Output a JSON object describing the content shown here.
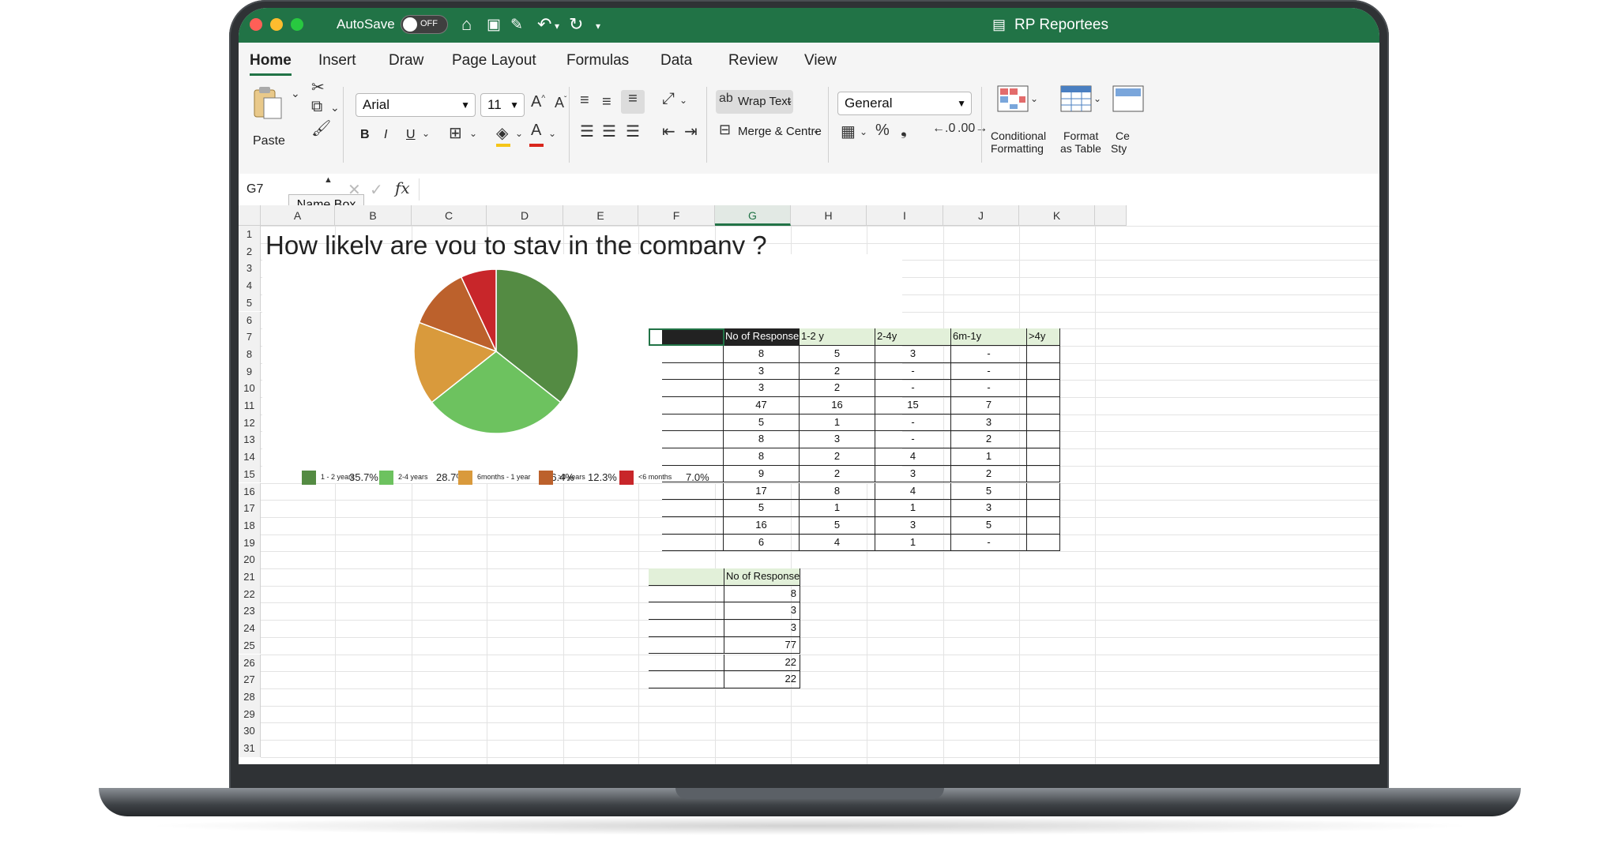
{
  "window": {
    "autosave_label": "AutoSave",
    "autosave_state": "OFF",
    "document_title": "RP Reportees",
    "accent": "#217346"
  },
  "ribbon_tabs": [
    "Home",
    "Insert",
    "Draw",
    "Page Layout",
    "Formulas",
    "Data",
    "Review",
    "View"
  ],
  "ribbon": {
    "paste_label": "Paste",
    "font_name": "Arial",
    "font_size": "11",
    "bold": "B",
    "italic": "I",
    "underline": "U",
    "wrap_text": "Wrap Text",
    "merge_centre": "Merge & Centre",
    "number_format": "General",
    "percent": "%",
    "comma": "❟",
    "conditional_formatting": [
      "Conditional",
      "Formatting"
    ],
    "format_as_table": [
      "Format",
      "as Table"
    ],
    "cell_styles": [
      "Ce",
      "Sty"
    ]
  },
  "formula_bar": {
    "name_box": "G7",
    "tooltip": "Name Box",
    "fx": "fx"
  },
  "columns": [
    "A",
    "B",
    "C",
    "D",
    "E",
    "F",
    "G",
    "H",
    "I",
    "J",
    "K"
  ],
  "selected_column": "G",
  "rows": [
    "1",
    "2",
    "3",
    "4",
    "5",
    "6",
    "7",
    "8",
    "9",
    "10",
    "11",
    "12",
    "13",
    "14",
    "15",
    "16",
    "17",
    "18",
    "19",
    "20",
    "21",
    "22",
    "23",
    "24",
    "25",
    "26",
    "27",
    "28",
    "29",
    "30",
    "31"
  ],
  "sheet_title": "How likely are you to stay in the company ?",
  "chart_data": {
    "type": "pie",
    "series": [
      {
        "name": "1 - 2 years",
        "value": 35.7,
        "label": "35.7%",
        "color": "#548b43"
      },
      {
        "name": "2-4 years",
        "value": 28.7,
        "label": "28.7%",
        "color": "#6dc25f"
      },
      {
        "name": "6months - 1 year",
        "value": 16.4,
        "label": "16.4%",
        "color": "#d99a3c"
      },
      {
        "name": ">4 years",
        "value": 12.3,
        "label": "12.3%",
        "color": "#bc612c"
      },
      {
        "name": "<6 months",
        "value": 7.0,
        "label": "7.0%",
        "color": "#c8262a"
      }
    ],
    "legend_position": "bottom"
  },
  "table1": {
    "headers": [
      "",
      "No of Responses",
      "1-2 y",
      "2-4y",
      "6m-1y",
      ">4y"
    ],
    "rows": [
      [
        "8",
        "5",
        "3",
        "-"
      ],
      [
        "3",
        "2",
        "-",
        "-"
      ],
      [
        "3",
        "2",
        "-",
        "-"
      ],
      [
        "47",
        "16",
        "15",
        "7"
      ],
      [
        "5",
        "1",
        "-",
        "3"
      ],
      [
        "8",
        "3",
        "-",
        "2"
      ],
      [
        "8",
        "2",
        "4",
        "1"
      ],
      [
        "9",
        "2",
        "3",
        "2"
      ],
      [
        "17",
        "8",
        "4",
        "5"
      ],
      [
        "5",
        "1",
        "1",
        "3"
      ],
      [
        "16",
        "5",
        "3",
        "5"
      ],
      [
        "6",
        "4",
        "1",
        "-"
      ]
    ]
  },
  "table2": {
    "header": "No of Responses",
    "values": [
      "8",
      "3",
      "3",
      "77",
      "22",
      "22"
    ]
  }
}
